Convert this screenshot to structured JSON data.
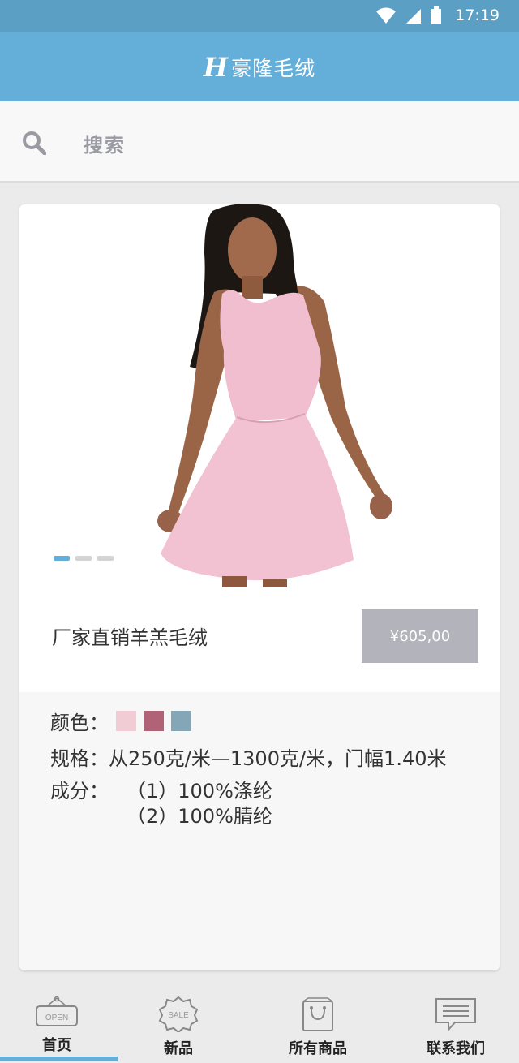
{
  "status_bar": {
    "time": "17:19"
  },
  "header": {
    "logo_mark": "H",
    "title": "豪隆毛绒"
  },
  "search": {
    "placeholder": "搜索"
  },
  "product": {
    "title": "厂家直销羊羔毛绒",
    "price": "¥605,00",
    "carousel": {
      "count": 3,
      "active_index": 0
    },
    "color_label": "颜色：",
    "colors": [
      "#f2ccd5",
      "#b06377",
      "#84a6b6"
    ],
    "spec_label": "规格：",
    "spec_value": "从250克/米—1300克/米，门幅1.40米",
    "composition_label": "成分：",
    "composition": [
      "（1）100%涤纶",
      "（2）100%腈纶"
    ]
  },
  "tabs": [
    {
      "label": "首页",
      "icon": "open-sign-icon",
      "active": true
    },
    {
      "label": "新品",
      "icon": "sale-badge-icon",
      "active": false
    },
    {
      "label": "所有商品",
      "icon": "shopping-bag-icon",
      "active": false
    },
    {
      "label": "联系我们",
      "icon": "message-icon",
      "active": false
    }
  ],
  "accent_color": "#64afda"
}
